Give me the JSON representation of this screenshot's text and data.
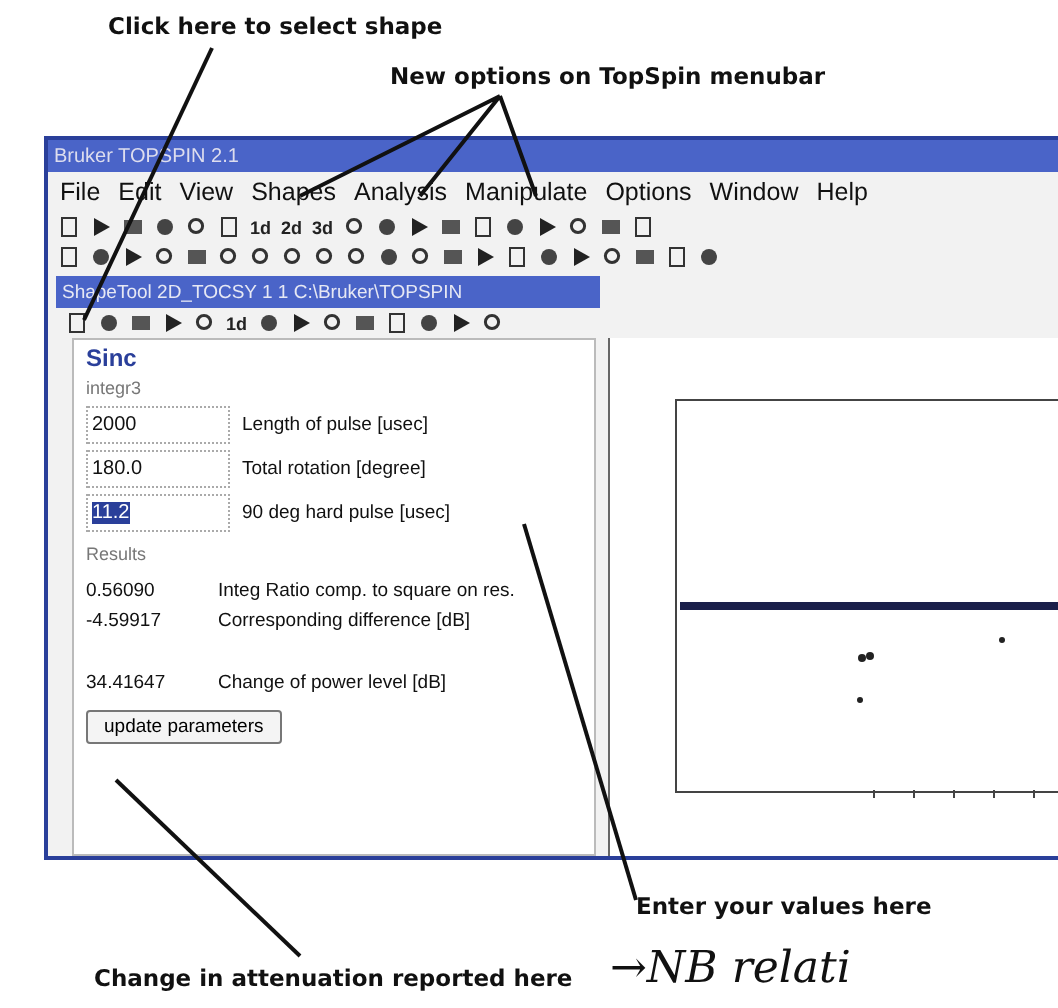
{
  "annotations": {
    "select_shape": "Click here to select shape",
    "new_options": "New options on TopSpin menubar",
    "enter_values": "Enter your values here",
    "attenuation": "Change in attenuation reported here",
    "handwritten_note": "→NB relati"
  },
  "window": {
    "title": "Bruker TOPSPIN 2.1",
    "menu": [
      "File",
      "Edit",
      "View",
      "Shapes",
      "Analysis",
      "Manipulate",
      "Options",
      "Window",
      "Help"
    ],
    "toolbar_labels": [
      "1d",
      "2d",
      "3d"
    ]
  },
  "shape_tool": {
    "title": "ShapeTool 2D_TOCSY 1 1 C:\\Bruker\\TOPSPIN",
    "toolbar_labels": [
      "1d"
    ],
    "shape_name": "Sinc",
    "subtitle": "integr3",
    "params": [
      {
        "value": "2000",
        "label": "Length of pulse [usec]",
        "selected": false
      },
      {
        "value": "180.0",
        "label": "Total rotation [degree]",
        "selected": false
      },
      {
        "value": "11.2",
        "label": "90 deg hard pulse [usec]",
        "selected": true
      }
    ],
    "results_heading": "Results",
    "results": [
      {
        "value": "0.56090",
        "label": "Integ Ratio comp. to square on res."
      },
      {
        "value": "-4.59917",
        "label": "Corresponding difference [dB]"
      },
      {
        "value": "34.41647",
        "label": "Change of power level [dB]"
      }
    ],
    "button": "update parameters"
  }
}
